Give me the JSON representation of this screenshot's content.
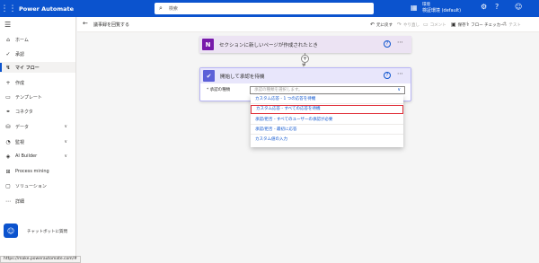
{
  "app": {
    "title": "Power Automate",
    "search_placeholder": "検索"
  },
  "environment": {
    "label": "環境",
    "name": "検証環境 (default)"
  },
  "sidebar": {
    "items": [
      {
        "label": "ホーム",
        "icon": "home-icon"
      },
      {
        "label": "承認",
        "icon": "approvals-icon"
      },
      {
        "label": "マイ フロー",
        "icon": "flows-icon"
      },
      {
        "label": "作成",
        "icon": "plus-icon"
      },
      {
        "label": "テンプレート",
        "icon": "templates-icon"
      },
      {
        "label": "コネクタ",
        "icon": "connectors-icon"
      },
      {
        "label": "データ",
        "icon": "data-icon"
      },
      {
        "label": "監視",
        "icon": "monitor-icon"
      },
      {
        "label": "AI Builder",
        "icon": "ai-icon"
      },
      {
        "label": "Process mining",
        "icon": "process-mining-icon"
      },
      {
        "label": "ソリューション",
        "icon": "solutions-icon"
      },
      {
        "label": "詳細",
        "icon": "more-icon"
      }
    ],
    "chatbot_label": "チャットボットに質問",
    "status_url": "https://make.powerautomate.com/#"
  },
  "command_bar": {
    "flow_name": "議事録を回覧する",
    "undo": "元に戻す",
    "redo": "やり直し",
    "comment": "コメント",
    "save": "保存",
    "checker": "フロー チェッカー",
    "test": "テスト"
  },
  "trigger": {
    "title": "セクションに新しいページが作成されたとき"
  },
  "approval": {
    "title": "開始して承認を待機",
    "field_label": "* 承認の種類",
    "field_placeholder": "承認の種類を選択します。"
  },
  "dropdown": {
    "options": [
      "カスタム応答 - 1 つの応答を待機",
      "カスタム応答 - すべての応答を待機",
      "承認/拒否 - すべてのユーザーの承認が必要",
      "承認/拒否 - 最初に応答",
      "カスタム値の入力"
    ],
    "highlighted_index": 1
  },
  "colors": {
    "brand": "#0b53ce",
    "highlight": "#e0313b",
    "onenote": "#7719aa",
    "approval": "#5c60d8"
  }
}
